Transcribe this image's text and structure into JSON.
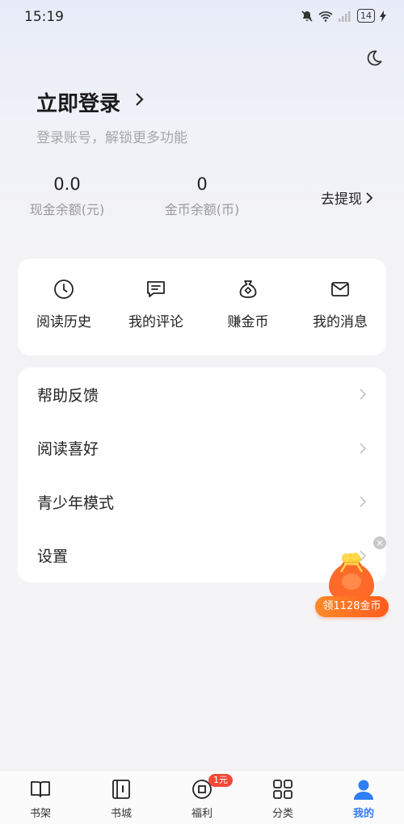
{
  "status": {
    "time": "15:19",
    "battery": "14"
  },
  "header": {
    "theme_icon": "moon-icon"
  },
  "login": {
    "title": "立即登录",
    "subtitle": "登录账号，解锁更多功能"
  },
  "stats": {
    "cash_value": "0.0",
    "cash_label": "现金余额(元)",
    "coin_value": "0",
    "coin_label": "金币余额(币)",
    "withdraw": "去提现"
  },
  "quick": [
    {
      "label": "阅读历史",
      "icon": "clock-icon"
    },
    {
      "label": "我的评论",
      "icon": "comment-icon"
    },
    {
      "label": "赚金币",
      "icon": "money-bag-icon"
    },
    {
      "label": "我的消息",
      "icon": "mail-icon"
    }
  ],
  "menu": [
    {
      "label": "帮助反馈"
    },
    {
      "label": "阅读喜好"
    },
    {
      "label": "青少年模式"
    },
    {
      "label": "设置"
    }
  ],
  "promo": {
    "label": "领1128金币"
  },
  "tabbar": [
    {
      "label": "书架",
      "icon": "bookshelf-icon"
    },
    {
      "label": "书城",
      "icon": "bookstore-icon"
    },
    {
      "label": "福利",
      "icon": "coin-icon",
      "badge": "1元"
    },
    {
      "label": "分类",
      "icon": "grid-icon"
    },
    {
      "label": "我的",
      "icon": "user-icon",
      "active": true
    }
  ],
  "colors": {
    "accent": "#2f7ff5",
    "promo": "#ff5b1c",
    "badge": "#f04a37"
  }
}
